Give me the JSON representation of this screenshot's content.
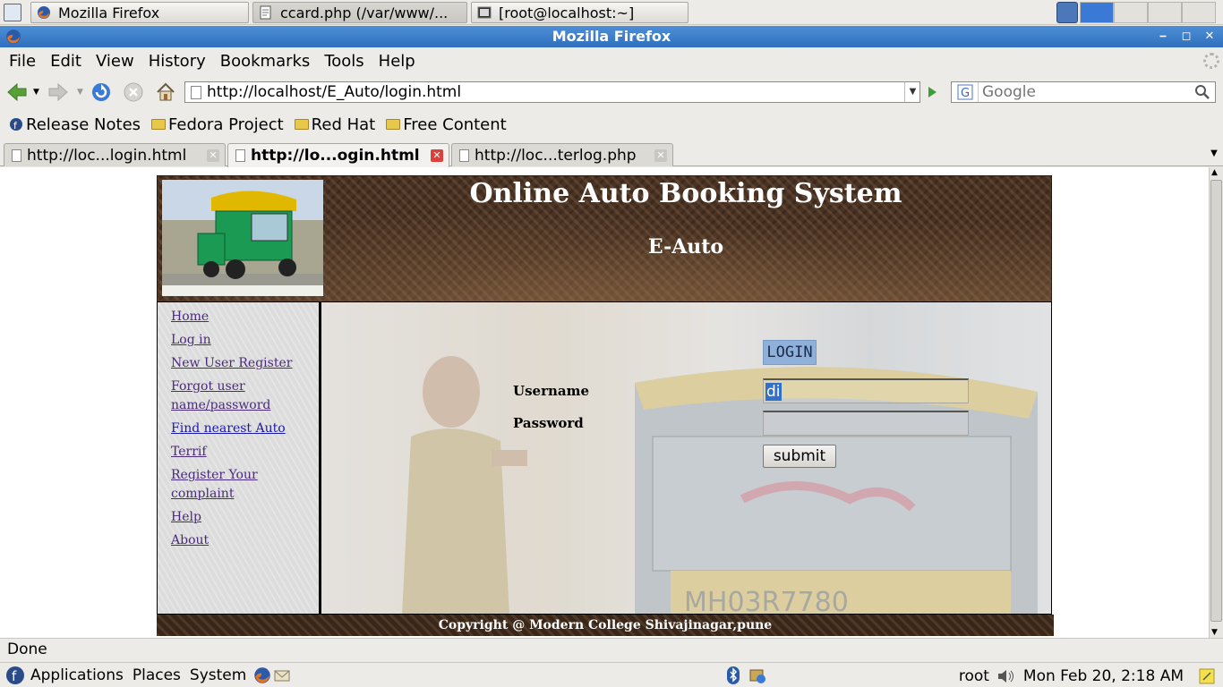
{
  "taskbar": {
    "tasks": [
      {
        "label": "Mozilla Firefox"
      },
      {
        "label": "ccard.php (/var/www/..."
      },
      {
        "label": "[root@localhost:~]"
      }
    ]
  },
  "window": {
    "title": "Mozilla Firefox"
  },
  "menubar": {
    "items": [
      "File",
      "Edit",
      "View",
      "History",
      "Bookmarks",
      "Tools",
      "Help"
    ]
  },
  "navigation": {
    "url": "http://localhost/E_Auto/login.html",
    "search_placeholder": "Google"
  },
  "bookmarks": {
    "items": [
      "Release Notes",
      "Fedora Project",
      "Red Hat",
      "Free Content"
    ]
  },
  "tabs": [
    {
      "label": "http://loc...login.html"
    },
    {
      "label": "http://lo...ogin.html"
    },
    {
      "label": "http://loc...terlog.php"
    }
  ],
  "page": {
    "title": "Online Auto Booking System",
    "subtitle": "E-Auto",
    "nav": [
      {
        "label": "Home"
      },
      {
        "label": "Log in"
      },
      {
        "label": "New User Register"
      },
      {
        "label": "Forgot user name/password"
      },
      {
        "label": "Find nearest Auto"
      },
      {
        "label": "Terrif"
      },
      {
        "label": "Register Your complaint"
      },
      {
        "label": "Help"
      },
      {
        "label": "About"
      }
    ],
    "login": {
      "heading": "LOGIN",
      "username_label": "Username",
      "username_value": "di",
      "password_label": "Password",
      "submit_label": "submit"
    },
    "footer": "Copyright @ Modern College Shivajinagar,pune"
  },
  "status": {
    "text": "Done"
  },
  "panel": {
    "menus": [
      "Applications",
      "Places",
      "System"
    ],
    "user": "root",
    "clock": "Mon Feb 20,  2:18 AM"
  },
  "colors": {
    "titlebar": "#3a7ad6",
    "banner": "#4a3222",
    "sidebar_link": "#4a2a7a",
    "selection": "#3170c9"
  }
}
